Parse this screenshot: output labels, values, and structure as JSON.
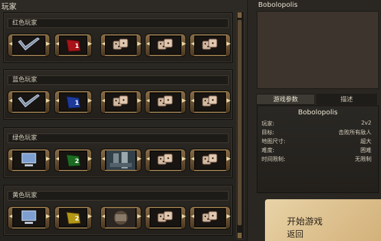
{
  "players_panel": {
    "header": "玩家"
  },
  "teams": [
    {
      "title": "红色玩家",
      "team_number": "1",
      "color": "#a8141a",
      "leader_kind": "checkmark"
    },
    {
      "title": "蓝色玩家",
      "team_number": "1",
      "color": "#1e3b9b",
      "leader_kind": "checkmark"
    },
    {
      "title": "绿色玩家",
      "team_number": "2",
      "color": "#1d6a22",
      "leader_kind": "computer"
    },
    {
      "title": "黄色玩家",
      "team_number": "2",
      "color": "#b39816",
      "leader_kind": "computer"
    }
  ],
  "map": {
    "title": "Bobolopolis"
  },
  "tabs": [
    {
      "label": "游戏参数",
      "active": true
    },
    {
      "label": "描述",
      "active": false
    }
  ],
  "info": {
    "map_name": "Bobolopolis",
    "rows": [
      {
        "k": "玩家:",
        "v": "2v2"
      },
      {
        "k": "目标:",
        "v": "击败所有敌人"
      },
      {
        "k": "地图尺寸:",
        "v": "超大"
      },
      {
        "k": "难度:",
        "v": "困难"
      },
      {
        "k": "时间限制:",
        "v": "无限制"
      }
    ]
  },
  "buttons": {
    "start": "开始游戏",
    "back": "返回"
  },
  "icons": {
    "checkmark": "checkmark-icon",
    "computer": "computer-icon",
    "banner": "team-banner-icon",
    "dice": "random-dice-icon",
    "portrait": "hero-portrait-icon"
  }
}
